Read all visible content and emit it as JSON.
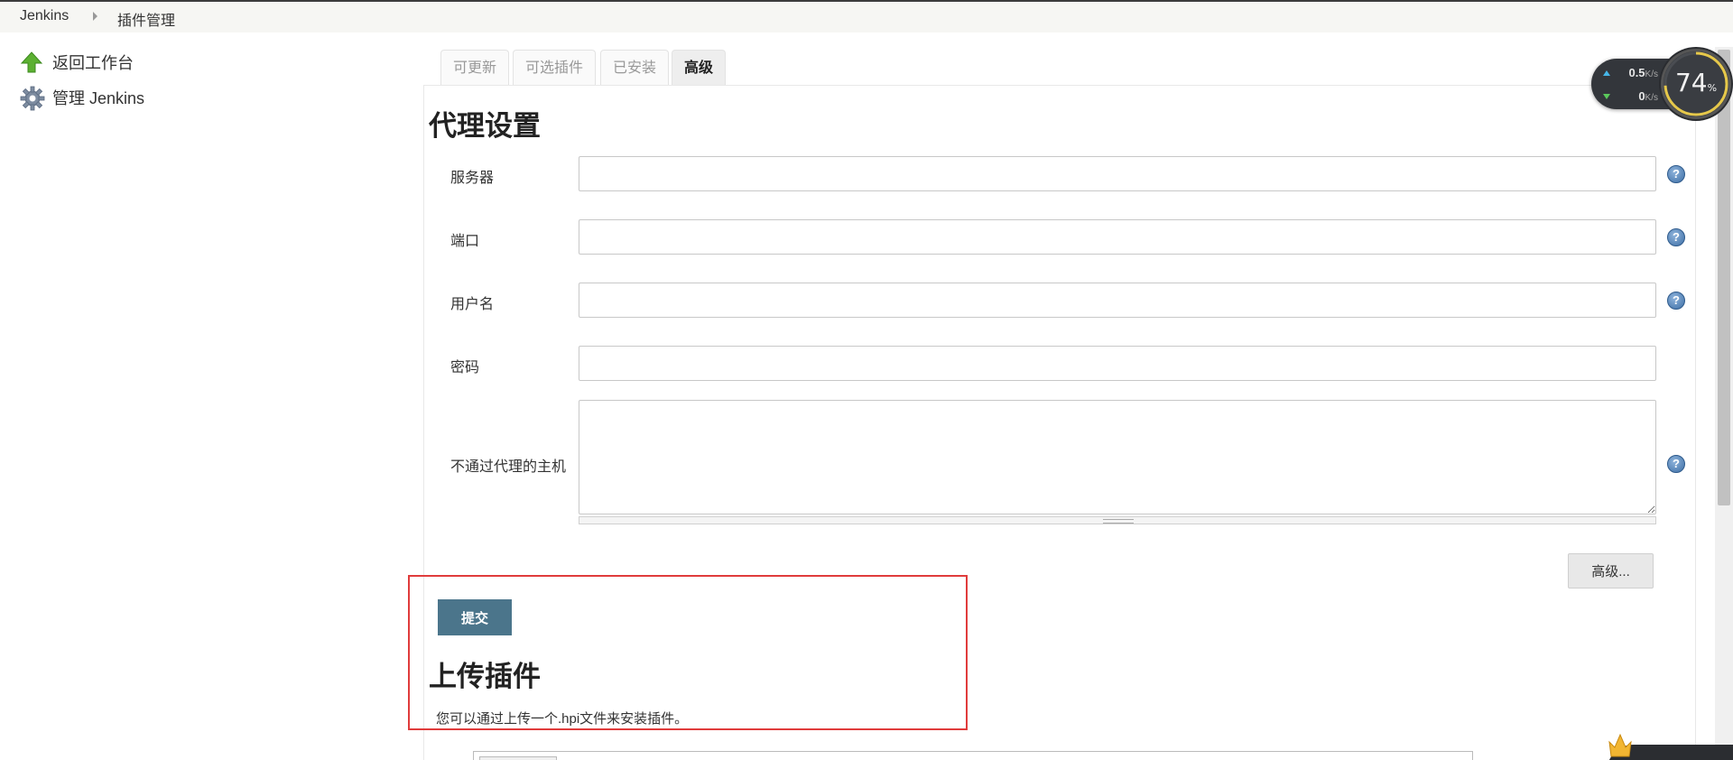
{
  "breadcrumb": {
    "root": "Jenkins",
    "current": "插件管理"
  },
  "sidebar": {
    "items": [
      {
        "label": "返回工作台",
        "icon": "up-arrow-icon"
      },
      {
        "label": "管理 Jenkins",
        "icon": "gear-icon"
      }
    ]
  },
  "tabs": [
    {
      "label": "可更新",
      "active": false
    },
    {
      "label": "可选插件",
      "active": false
    },
    {
      "label": "已安装",
      "active": false
    },
    {
      "label": "高级",
      "active": true
    }
  ],
  "proxy": {
    "title": "代理设置",
    "fields": {
      "server": {
        "label": "服务器",
        "value": ""
      },
      "port": {
        "label": "端口",
        "value": ""
      },
      "username": {
        "label": "用户名",
        "value": ""
      },
      "password": {
        "label": "密码",
        "value": ""
      },
      "no_proxy_hosts": {
        "label": "不通过代理的主机",
        "value": ""
      }
    },
    "advanced_label": "高级...",
    "submit_label": "提交"
  },
  "upload": {
    "title": "上传插件",
    "description": "您可以通过上传一个.hpi文件来安装插件。"
  },
  "net_monitor": {
    "up_value": "0.5",
    "up_unit": "K/s",
    "down_value": "0",
    "down_unit": "K/s",
    "percent": "74",
    "percent_sign": "%"
  },
  "colors": {
    "submit_bg": "#4b758b",
    "highlight_border": "#e03c3c",
    "help_icon": "#3d6ea5"
  }
}
